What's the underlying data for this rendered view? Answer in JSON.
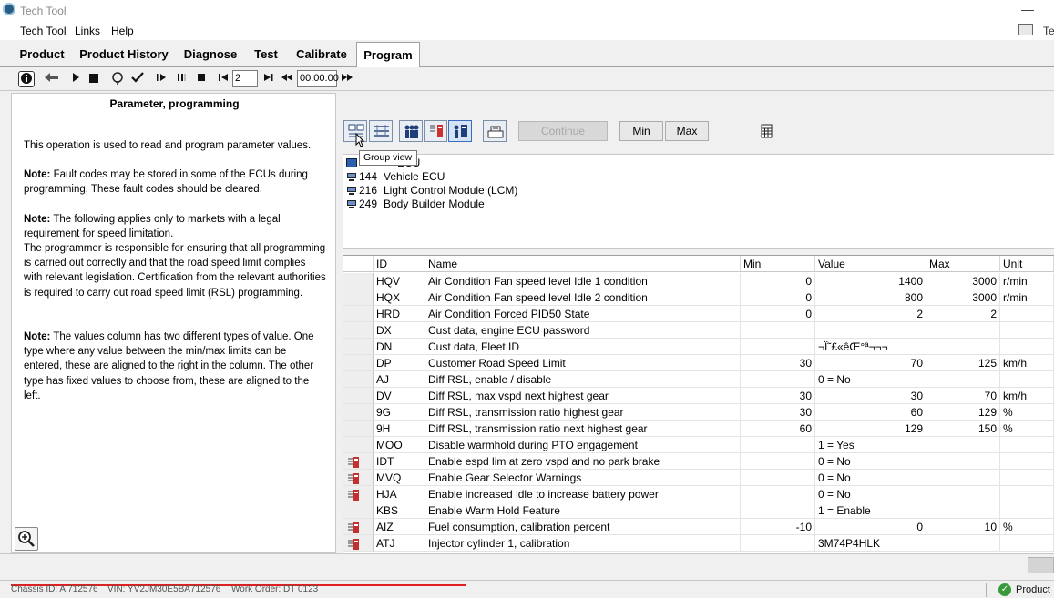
{
  "window": {
    "title": "Tech Tool"
  },
  "menu": [
    "Tech Tool",
    "Links",
    "Help"
  ],
  "menu_right_text": "Te",
  "tabs": [
    "Product",
    "Product History",
    "Diagnose",
    "Test",
    "Calibrate",
    "Program"
  ],
  "active_tab": "Program",
  "toolbar": {
    "step_value": "2",
    "time_value": "00:00:00"
  },
  "left_panel": {
    "heading": "Parameter, programming",
    "intro": "This operation is used to read and program parameter values.",
    "note_label": "Note:",
    "note1": " Fault codes may be stored in some of the ECUs during programming. These fault codes should be cleared.",
    "note2a": " The following applies only to markets with a legal requirement for speed limitation.",
    "note2b": "The programmer is responsible for ensuring that all programming is carried out correctly and that the road speed limit complies with relevant legislation. Certification from the relevant authorities is required to carry out road speed limit (RSL) programming.",
    "note3": " The values column has two different types of value. One type where any value between the min/max limits can be entered, these are aligned to the right in the column. The other type has fixed values to choose from, these are aligned to the left."
  },
  "right_panel": {
    "continue_label": "Continue",
    "min_label": "Min",
    "max_label": "Max",
    "tooltip": "Group view",
    "ecus": [
      {
        "num": "",
        "name": "ECU"
      },
      {
        "num": "144",
        "name": "Vehicle ECU"
      },
      {
        "num": "216",
        "name": "Light Control Module (LCM)"
      },
      {
        "num": "249",
        "name": "Body Builder Module"
      }
    ]
  },
  "table": {
    "columns": [
      "",
      "ID",
      "Name",
      "Min",
      "Value",
      "Max",
      "Unit"
    ],
    "rows": [
      {
        "icon": false,
        "id": "HQV",
        "name": "Air Condition Fan speed level Idle 1 condition",
        "min": "0",
        "value": "1400",
        "value_align": "r",
        "max": "3000",
        "unit": "r/min"
      },
      {
        "icon": false,
        "id": "HQX",
        "name": "Air Condition Fan speed level Idle 2 condition",
        "min": "0",
        "value": "800",
        "value_align": "r",
        "max": "3000",
        "unit": "r/min"
      },
      {
        "icon": false,
        "id": "HRD",
        "name": "Air Condition Forced PID50 State",
        "min": "0",
        "value": "2",
        "value_align": "r",
        "max": "2",
        "unit": ""
      },
      {
        "icon": false,
        "id": "DX",
        "name": "Cust data, engine ECU password",
        "min": "",
        "value": "",
        "value_align": "l",
        "max": "",
        "unit": ""
      },
      {
        "icon": false,
        "id": "DN",
        "name": "Cust data, Fleet ID",
        "min": "",
        "value": "¬Ï˜£«êŒ°ª¬¬¬",
        "value_align": "l",
        "max": "",
        "unit": ""
      },
      {
        "icon": false,
        "id": "DP",
        "name": "Customer Road Speed Limit",
        "min": "30",
        "value": "70",
        "value_align": "r",
        "max": "125",
        "unit": "km/h"
      },
      {
        "icon": false,
        "id": "AJ",
        "name": "Diff RSL, enable / disable",
        "min": "",
        "value": "0 = No",
        "value_align": "l",
        "max": "",
        "unit": ""
      },
      {
        "icon": false,
        "id": "DV",
        "name": "Diff RSL, max vspd next highest gear",
        "min": "30",
        "value": "30",
        "value_align": "r",
        "max": "70",
        "unit": "km/h"
      },
      {
        "icon": false,
        "id": "9G",
        "name": "Diff RSL, transmission ratio highest gear",
        "min": "30",
        "value": "60",
        "value_align": "r",
        "max": "129",
        "unit": "%"
      },
      {
        "icon": false,
        "id": "9H",
        "name": "Diff RSL, transmission ratio next highest gear",
        "min": "60",
        "value": "129",
        "value_align": "r",
        "max": "150",
        "unit": "%"
      },
      {
        "icon": false,
        "id": "MOO",
        "name": "Disable warmhold during PTO engagement",
        "min": "",
        "value": "1 = Yes",
        "value_align": "l",
        "max": "",
        "unit": ""
      },
      {
        "icon": true,
        "id": "IDT",
        "name": "Enable espd lim at zero vspd and no park brake",
        "min": "",
        "value": "0 = No",
        "value_align": "l",
        "max": "",
        "unit": ""
      },
      {
        "icon": true,
        "id": "MVQ",
        "name": "Enable Gear Selector Warnings",
        "min": "",
        "value": "0 = No",
        "value_align": "l",
        "max": "",
        "unit": ""
      },
      {
        "icon": true,
        "id": "HJA",
        "name": "Enable increased idle to increase battery power",
        "min": "",
        "value": "0 = No",
        "value_align": "l",
        "max": "",
        "unit": ""
      },
      {
        "icon": false,
        "id": "KBS",
        "name": "Enable Warm Hold Feature",
        "min": "",
        "value": "1 = Enable",
        "value_align": "l",
        "max": "",
        "unit": ""
      },
      {
        "icon": true,
        "id": "AIZ",
        "name": "Fuel consumption, calibration percent",
        "min": "-10",
        "value": "0",
        "value_align": "r",
        "max": "10",
        "unit": "%"
      },
      {
        "icon": true,
        "id": "ATJ",
        "name": "Injector cylinder 1, calibration",
        "min": "",
        "value": "3M74P4HLK",
        "value_align": "l",
        "max": "",
        "unit": ""
      }
    ]
  },
  "status": {
    "chassis": "Chassis ID: A 712576",
    "vin": "VIN: YV2JM30E5BA712576",
    "work_order": "Work Order: DT 0123",
    "product": "Product"
  }
}
